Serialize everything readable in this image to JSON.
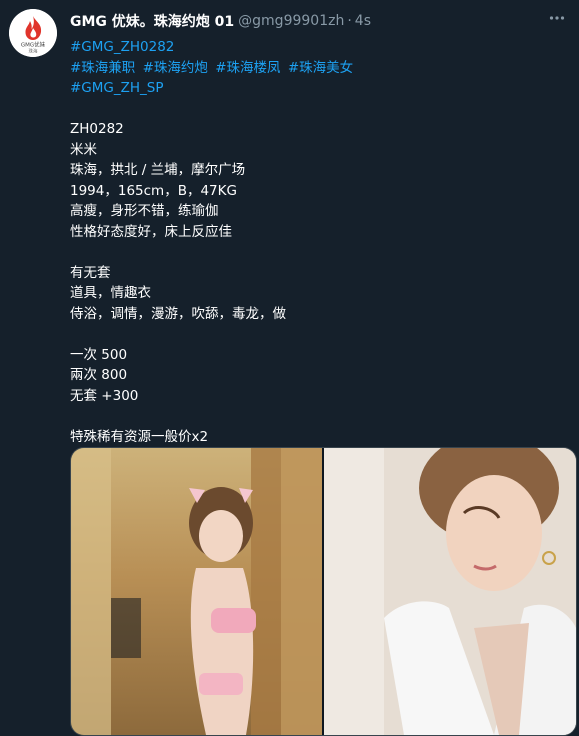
{
  "account": {
    "display_name": "GMG 优妹。珠海约炮 01",
    "handle": "@gmg99901zh",
    "separator": "·",
    "timestamp": "4s",
    "avatar_text": "GMG优妹",
    "avatar_subtext": "珠海"
  },
  "tweet": {
    "hashtag_line1": "#GMG_ZH0282",
    "hashtags_line2": [
      "#珠海兼职",
      "#珠海约炮",
      "#珠海楼凤",
      "#珠海美女"
    ],
    "hashtag_line3": "#GMG_ZH_SP",
    "profile": {
      "code": "ZH0282",
      "name": "米米",
      "location": "珠海，拱北 / 兰埔，摩尔广场",
      "stats": "1994，165cm，B，47KG",
      "desc1": "高瘦，身形不错，练瑜伽",
      "desc2": "性格好态度好，床上反应佳"
    },
    "services": {
      "line1": "有无套",
      "line2": "道具，情趣衣",
      "line3": "侍浴，调情，漫游，吹舔，毒龙，做"
    },
    "pricing": {
      "line1": "一次 500",
      "line2": "兩次 800",
      "line3": "无套 +300"
    },
    "note": "特殊稀有资源一般价x2"
  },
  "colors": {
    "background": "#15202b",
    "text": "#ffffff",
    "secondary": "#8899a6",
    "link": "#1da1f2",
    "avatar_flame": "#e0342b"
  },
  "icons": {
    "more": "more-dots-icon"
  }
}
